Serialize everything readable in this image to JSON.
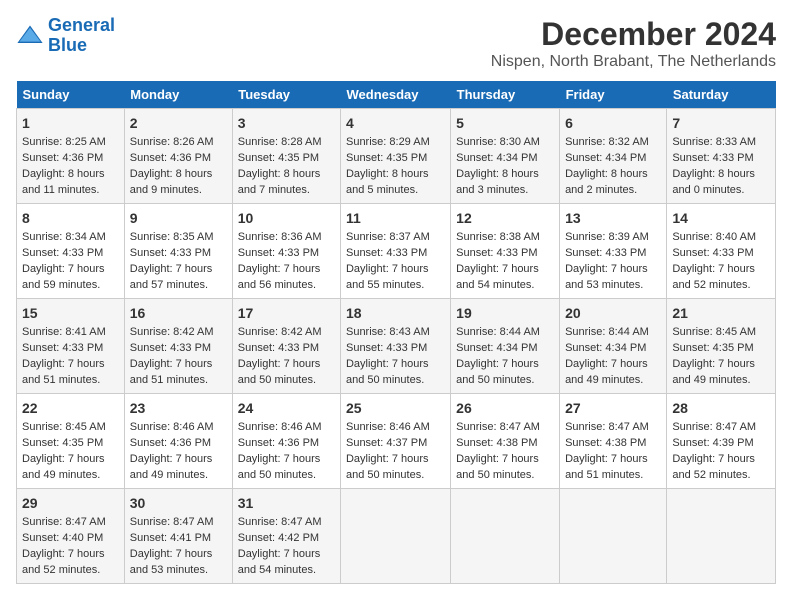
{
  "header": {
    "logo_line1": "General",
    "logo_line2": "Blue",
    "title": "December 2024",
    "subtitle": "Nispen, North Brabant, The Netherlands"
  },
  "days_of_week": [
    "Sunday",
    "Monday",
    "Tuesday",
    "Wednesday",
    "Thursday",
    "Friday",
    "Saturday"
  ],
  "weeks": [
    [
      {
        "day": "1",
        "sunrise": "Sunrise: 8:25 AM",
        "sunset": "Sunset: 4:36 PM",
        "daylight": "Daylight: 8 hours and 11 minutes."
      },
      {
        "day": "2",
        "sunrise": "Sunrise: 8:26 AM",
        "sunset": "Sunset: 4:36 PM",
        "daylight": "Daylight: 8 hours and 9 minutes."
      },
      {
        "day": "3",
        "sunrise": "Sunrise: 8:28 AM",
        "sunset": "Sunset: 4:35 PM",
        "daylight": "Daylight: 8 hours and 7 minutes."
      },
      {
        "day": "4",
        "sunrise": "Sunrise: 8:29 AM",
        "sunset": "Sunset: 4:35 PM",
        "daylight": "Daylight: 8 hours and 5 minutes."
      },
      {
        "day": "5",
        "sunrise": "Sunrise: 8:30 AM",
        "sunset": "Sunset: 4:34 PM",
        "daylight": "Daylight: 8 hours and 3 minutes."
      },
      {
        "day": "6",
        "sunrise": "Sunrise: 8:32 AM",
        "sunset": "Sunset: 4:34 PM",
        "daylight": "Daylight: 8 hours and 2 minutes."
      },
      {
        "day": "7",
        "sunrise": "Sunrise: 8:33 AM",
        "sunset": "Sunset: 4:33 PM",
        "daylight": "Daylight: 8 hours and 0 minutes."
      }
    ],
    [
      {
        "day": "8",
        "sunrise": "Sunrise: 8:34 AM",
        "sunset": "Sunset: 4:33 PM",
        "daylight": "Daylight: 7 hours and 59 minutes."
      },
      {
        "day": "9",
        "sunrise": "Sunrise: 8:35 AM",
        "sunset": "Sunset: 4:33 PM",
        "daylight": "Daylight: 7 hours and 57 minutes."
      },
      {
        "day": "10",
        "sunrise": "Sunrise: 8:36 AM",
        "sunset": "Sunset: 4:33 PM",
        "daylight": "Daylight: 7 hours and 56 minutes."
      },
      {
        "day": "11",
        "sunrise": "Sunrise: 8:37 AM",
        "sunset": "Sunset: 4:33 PM",
        "daylight": "Daylight: 7 hours and 55 minutes."
      },
      {
        "day": "12",
        "sunrise": "Sunrise: 8:38 AM",
        "sunset": "Sunset: 4:33 PM",
        "daylight": "Daylight: 7 hours and 54 minutes."
      },
      {
        "day": "13",
        "sunrise": "Sunrise: 8:39 AM",
        "sunset": "Sunset: 4:33 PM",
        "daylight": "Daylight: 7 hours and 53 minutes."
      },
      {
        "day": "14",
        "sunrise": "Sunrise: 8:40 AM",
        "sunset": "Sunset: 4:33 PM",
        "daylight": "Daylight: 7 hours and 52 minutes."
      }
    ],
    [
      {
        "day": "15",
        "sunrise": "Sunrise: 8:41 AM",
        "sunset": "Sunset: 4:33 PM",
        "daylight": "Daylight: 7 hours and 51 minutes."
      },
      {
        "day": "16",
        "sunrise": "Sunrise: 8:42 AM",
        "sunset": "Sunset: 4:33 PM",
        "daylight": "Daylight: 7 hours and 51 minutes."
      },
      {
        "day": "17",
        "sunrise": "Sunrise: 8:42 AM",
        "sunset": "Sunset: 4:33 PM",
        "daylight": "Daylight: 7 hours and 50 minutes."
      },
      {
        "day": "18",
        "sunrise": "Sunrise: 8:43 AM",
        "sunset": "Sunset: 4:33 PM",
        "daylight": "Daylight: 7 hours and 50 minutes."
      },
      {
        "day": "19",
        "sunrise": "Sunrise: 8:44 AM",
        "sunset": "Sunset: 4:34 PM",
        "daylight": "Daylight: 7 hours and 50 minutes."
      },
      {
        "day": "20",
        "sunrise": "Sunrise: 8:44 AM",
        "sunset": "Sunset: 4:34 PM",
        "daylight": "Daylight: 7 hours and 49 minutes."
      },
      {
        "day": "21",
        "sunrise": "Sunrise: 8:45 AM",
        "sunset": "Sunset: 4:35 PM",
        "daylight": "Daylight: 7 hours and 49 minutes."
      }
    ],
    [
      {
        "day": "22",
        "sunrise": "Sunrise: 8:45 AM",
        "sunset": "Sunset: 4:35 PM",
        "daylight": "Daylight: 7 hours and 49 minutes."
      },
      {
        "day": "23",
        "sunrise": "Sunrise: 8:46 AM",
        "sunset": "Sunset: 4:36 PM",
        "daylight": "Daylight: 7 hours and 49 minutes."
      },
      {
        "day": "24",
        "sunrise": "Sunrise: 8:46 AM",
        "sunset": "Sunset: 4:36 PM",
        "daylight": "Daylight: 7 hours and 50 minutes."
      },
      {
        "day": "25",
        "sunrise": "Sunrise: 8:46 AM",
        "sunset": "Sunset: 4:37 PM",
        "daylight": "Daylight: 7 hours and 50 minutes."
      },
      {
        "day": "26",
        "sunrise": "Sunrise: 8:47 AM",
        "sunset": "Sunset: 4:38 PM",
        "daylight": "Daylight: 7 hours and 50 minutes."
      },
      {
        "day": "27",
        "sunrise": "Sunrise: 8:47 AM",
        "sunset": "Sunset: 4:38 PM",
        "daylight": "Daylight: 7 hours and 51 minutes."
      },
      {
        "day": "28",
        "sunrise": "Sunrise: 8:47 AM",
        "sunset": "Sunset: 4:39 PM",
        "daylight": "Daylight: 7 hours and 52 minutes."
      }
    ],
    [
      {
        "day": "29",
        "sunrise": "Sunrise: 8:47 AM",
        "sunset": "Sunset: 4:40 PM",
        "daylight": "Daylight: 7 hours and 52 minutes."
      },
      {
        "day": "30",
        "sunrise": "Sunrise: 8:47 AM",
        "sunset": "Sunset: 4:41 PM",
        "daylight": "Daylight: 7 hours and 53 minutes."
      },
      {
        "day": "31",
        "sunrise": "Sunrise: 8:47 AM",
        "sunset": "Sunset: 4:42 PM",
        "daylight": "Daylight: 7 hours and 54 minutes."
      },
      null,
      null,
      null,
      null
    ]
  ]
}
